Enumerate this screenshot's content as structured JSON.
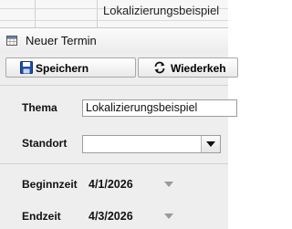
{
  "background": {
    "cell_text": "Lokalizierungsbeispiel"
  },
  "dialog": {
    "title": "Neuer Termin",
    "icons": {
      "window": "calendar-icon",
      "save": "floppy-disk-icon",
      "repeat": "recurrence-icon"
    },
    "toolbar": {
      "save_label": "Speichern",
      "repeat_label": "Wiederkeh"
    },
    "fields": {
      "subject_label": "Thema",
      "subject_value": "Lokalizierungsbeispiel",
      "location_label": "Standort",
      "location_value": "",
      "start_label": "Beginnzeit",
      "start_value": "4/1/2026",
      "end_label": "Endzeit",
      "end_value": "4/3/2026"
    },
    "colors": {
      "accent": "#1f4fa8",
      "background": "#eeeeee"
    }
  }
}
